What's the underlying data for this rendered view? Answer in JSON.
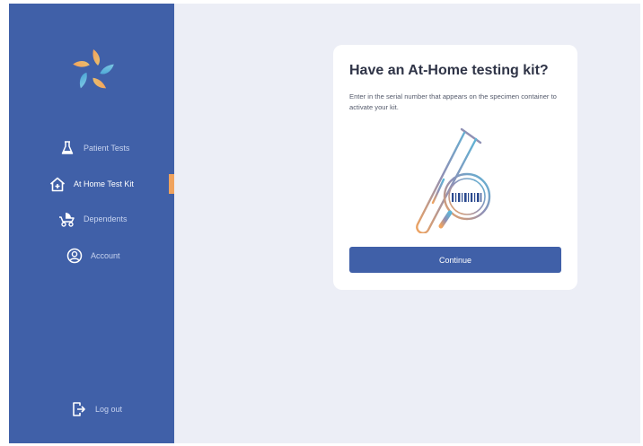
{
  "sidebar": {
    "items": [
      {
        "label": "Patient Tests",
        "icon": "flask-icon",
        "active": false
      },
      {
        "label": "At Home Test Kit",
        "icon": "home-plus-icon",
        "active": true
      },
      {
        "label": "Dependents",
        "icon": "stroller-icon",
        "active": false
      },
      {
        "label": "Account",
        "icon": "user-circle-icon",
        "active": false
      }
    ],
    "logout_label": "Log out",
    "logout_icon": "logout-icon"
  },
  "card": {
    "title": "Have an At-Home testing kit?",
    "description": "Enter in the serial number that appears on the specimen container to activate your kit.",
    "continue_label": "Continue"
  },
  "colors": {
    "sidebar": "#4060a8",
    "accent": "#f0a35e",
    "background": "#eceef6",
    "button": "#4060a8"
  }
}
